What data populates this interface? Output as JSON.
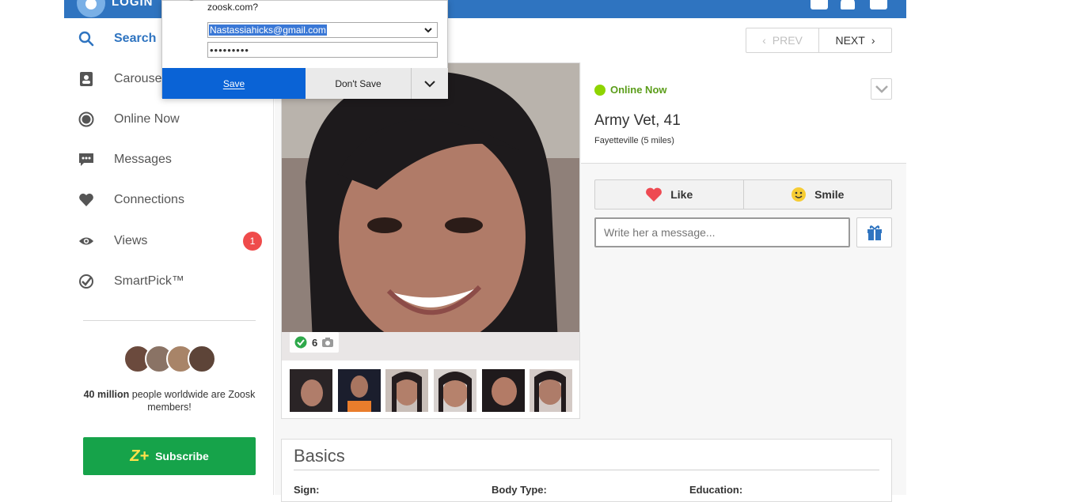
{
  "topbar": {
    "brand": "LOGIN",
    "icons": [
      "edit-icon",
      "bell-icon",
      "chat-icon"
    ]
  },
  "sidebar": {
    "items": [
      {
        "label": "Search",
        "icon": "search-icon",
        "active": true
      },
      {
        "label": "Carousel",
        "icon": "carousel-icon"
      },
      {
        "label": "Online Now",
        "icon": "online-icon"
      },
      {
        "label": "Messages",
        "icon": "messages-icon"
      },
      {
        "label": "Connections",
        "icon": "heart-icon"
      },
      {
        "label": "Views",
        "icon": "eye-icon",
        "badge": "1"
      },
      {
        "label": "SmartPick™",
        "icon": "smartpick-icon"
      }
    ],
    "members_bold": "40 million",
    "members_rest": " people worldwide are Zoosk members!",
    "subscribe_label": "Subscribe",
    "subscribe_logo": "Z+"
  },
  "pager": {
    "prev": "PREV",
    "next": "NEXT"
  },
  "profile": {
    "online_status": "Online Now",
    "name_age": "Army Vet, 41",
    "location": "Fayetteville (5 miles)",
    "photo_count": "6",
    "thumbnails": 6
  },
  "actions": {
    "like": "Like",
    "smile": "Smile",
    "message_placeholder": "Write her a message..."
  },
  "basics": {
    "title": "Basics",
    "fields": [
      "Sign:",
      "Body Type:",
      "Education:"
    ]
  },
  "password_dialog": {
    "question": "zoosk.com?",
    "username": "Nastassiahicks@gmail.com",
    "password_mask": "•••••••••",
    "save": "Save",
    "dont_save": "Don't Save"
  },
  "colors": {
    "brand_blue": "#2f74c0",
    "subscribe_green": "#16a34a",
    "online_green": "#8ed400",
    "badge_red": "#ef4b4b",
    "dialog_save_blue": "#0a63d6"
  }
}
